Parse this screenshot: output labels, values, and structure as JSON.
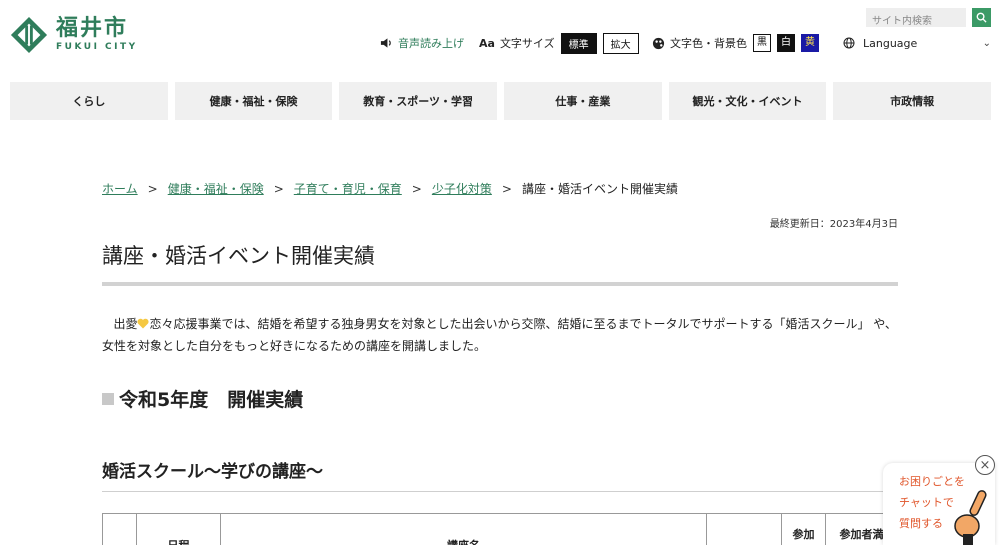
{
  "header": {
    "logo_ja": "福井市",
    "logo_en": "FUKUI CITY",
    "voice_label": "音声読み上げ",
    "text_size_label": "文字サイズ",
    "text_size_icon": "Aa",
    "size_standard": "標準",
    "size_large": "拡大",
    "color_label": "文字色・背景色",
    "color_black": "黒",
    "color_white": "白",
    "color_yellow": "黄",
    "language_label": "Language",
    "search_placeholder": "サイト内検索",
    "accent_color": "#2f7d5b"
  },
  "nav": {
    "items": [
      "くらし",
      "健康・福祉・保険",
      "教育・スポーツ・学習",
      "仕事・産業",
      "観光・文化・イベント",
      "市政情報"
    ]
  },
  "breadcrumb": {
    "home": "ホーム",
    "level1": "健康・福祉・保険",
    "level2": "子育て・育児・保育",
    "level3": "少子化対策",
    "current": "講座・婚活イベント開催実績",
    "separator": ">"
  },
  "page": {
    "updated": "最終更新日：2023年4月3日",
    "title": "講座・婚活イベント開催実績",
    "lead_before_heart": "出愛",
    "lead_after_heart": "恋々応援事業では、結婚を希望する独身男女を対象とした出会いから交際、結婚に至るまでトータルでサポートする「婚活スクール」 や、女性を対象とした自分をもっと好きになるための講座を開講しました。",
    "section_title": "令和5年度　開催実績",
    "subsection_title": "婚活スクール～学びの講座～"
  },
  "table": {
    "headers": [
      "",
      "日程",
      "講座名",
      "",
      "参加",
      "参加者満"
    ]
  },
  "chat": {
    "line1": "お困りごとを",
    "line2": "チャットで",
    "line3": "質問する",
    "close_symbol": "×"
  }
}
